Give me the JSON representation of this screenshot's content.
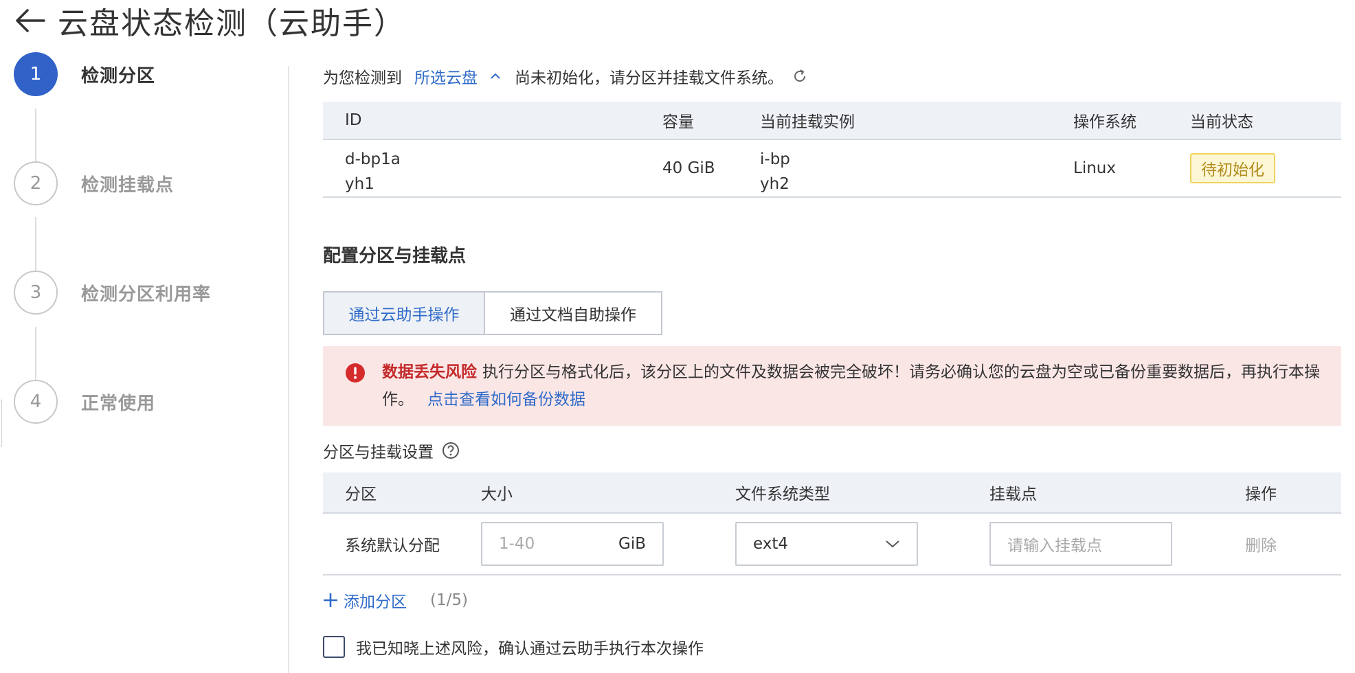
{
  "header": {
    "title": "云盘状态检测（云助手）"
  },
  "steps": [
    {
      "num": "1",
      "label": "检测分区",
      "state": "active"
    },
    {
      "num": "2",
      "label": "检测挂载点",
      "state": "idle"
    },
    {
      "num": "3",
      "label": "检测分区利用率",
      "state": "idle"
    },
    {
      "num": "4",
      "label": "正常使用",
      "state": "idle"
    }
  ],
  "detect": {
    "prefix": "为您检测到",
    "link": "所选云盘",
    "suffix": "尚未初始化，请分区并挂载文件系统。"
  },
  "disk_table": {
    "headers": {
      "id": "ID",
      "capacity": "容量",
      "instance": "当前挂载实例",
      "os": "操作系统",
      "status": "当前状态"
    },
    "row": {
      "id_link": "d-bp1a",
      "id_sub": "yh1",
      "capacity": "40 GiB",
      "instance_link": "i-bp",
      "instance_sub": "yh2",
      "os": "Linux",
      "status": "待初始化"
    }
  },
  "config": {
    "title": "配置分区与挂载点"
  },
  "tabs": [
    {
      "label": "通过云助手操作",
      "active": true
    },
    {
      "label": "通过文档自助操作",
      "active": false
    }
  ],
  "alert": {
    "title": "数据丢失风险",
    "message": "执行分区与格式化后，该分区上的文件及数据会被完全破坏！请务必确认您的云盘为空或已备份重要数据后，再执行本操作。",
    "link": "点击查看如何备份数据"
  },
  "partition": {
    "title": "分区与挂载设置",
    "headers": {
      "partition": "分区",
      "size": "大小",
      "fs": "文件系统类型",
      "mount": "挂载点",
      "action": "操作"
    },
    "row": {
      "partition": "系统默认分配",
      "size_placeholder": "1-40",
      "size_unit": "GiB",
      "fs": "ext4",
      "mount_placeholder": "请输入挂载点",
      "action": "删除"
    },
    "add_label": "添加分区",
    "count": "(1/5)"
  },
  "confirm": {
    "label": "我已知晓上述风险，确认通过云助手执行本次操作"
  },
  "colors": {
    "primary": "#3062c8",
    "link": "#2f6bc9",
    "danger": "#c42a2a",
    "alert_bg": "#fbe6e6",
    "warn_bg": "#fdf7d6"
  }
}
